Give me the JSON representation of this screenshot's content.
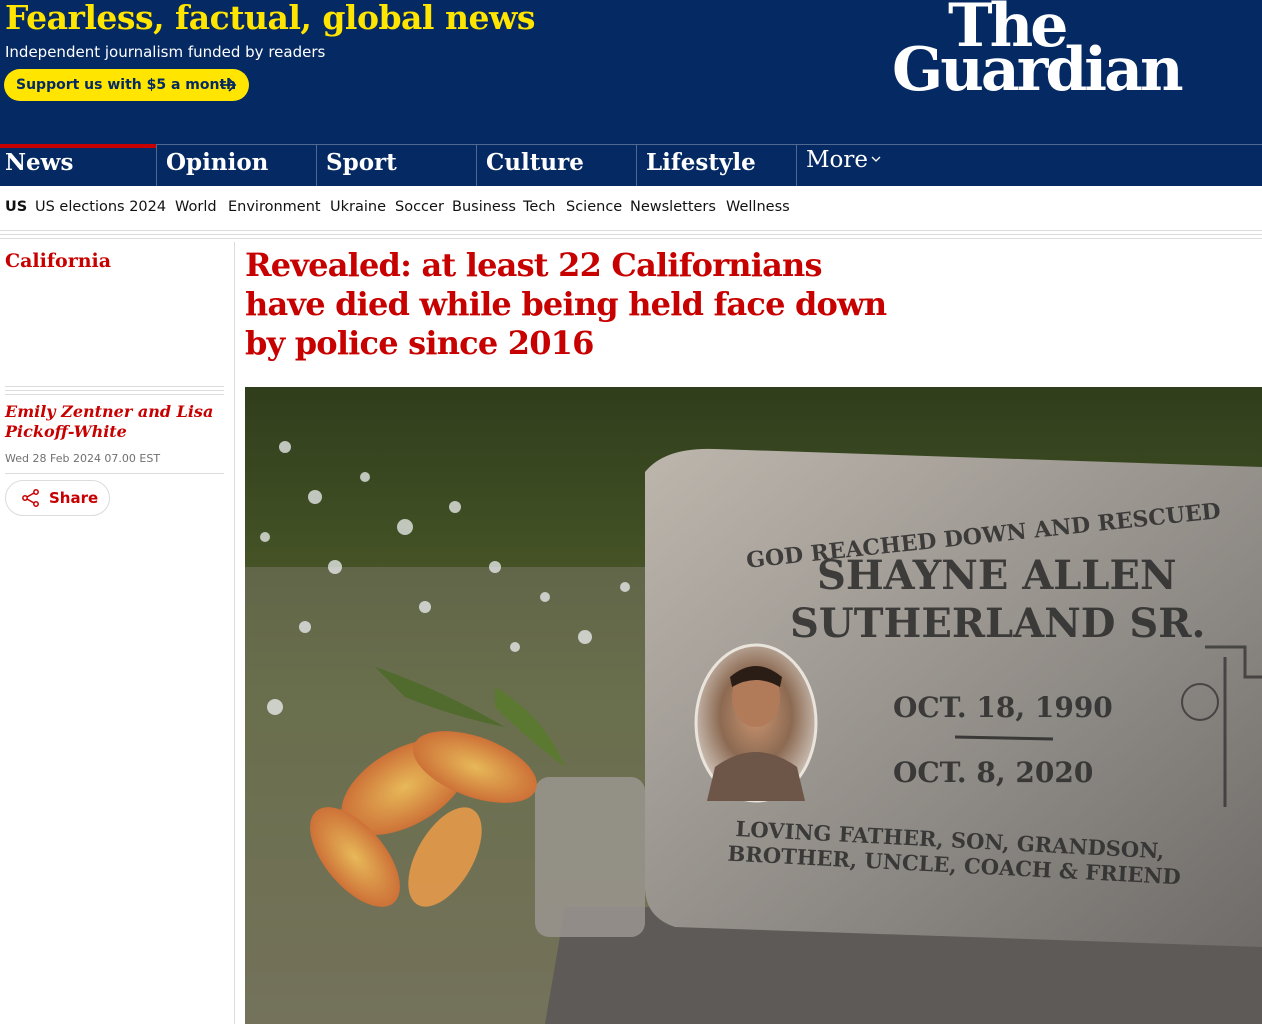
{
  "masthead": {
    "tagline": "Fearless, factual, global news",
    "subline": "Independent journalism funded by readers",
    "support_label": "Support us with $5 a month",
    "logo_line1": "The",
    "logo_line2": "Guardian",
    "bg_color": "#052962",
    "accent_color": "#ffe500"
  },
  "pillars": [
    {
      "label": "News",
      "active": true
    },
    {
      "label": "Opinion"
    },
    {
      "label": "Sport"
    },
    {
      "label": "Culture"
    },
    {
      "label": "Lifestyle"
    },
    {
      "label": "More"
    }
  ],
  "subnav": [
    "US",
    "US elections 2024",
    "World",
    "Environment",
    "Ukraine",
    "Soccer",
    "Business",
    "Tech",
    "Science",
    "Newsletters",
    "Wellness"
  ],
  "article": {
    "section": "California",
    "byline": "Emily Zentner and Lisa Pickoff-White",
    "date": "Wed 28 Feb 2024 07.00 EST",
    "share_label": "Share",
    "headline": "Revealed: at least 22 Californians have died while being held face down by police since 2016",
    "accent_color": "#c70000"
  },
  "hero_image": {
    "alt_subject": "headstone with flowers",
    "engraving": {
      "arc": "GOD REACHED DOWN AND RESCUED",
      "name1": "SHAYNE ALLEN",
      "name2": "SUTHERLAND SR.",
      "born": "OCT. 18, 1990",
      "died": "OCT. 8, 2020",
      "epitaph1": "LOVING FATHER, SON, GRANDSON,",
      "epitaph2": "BROTHER, UNCLE, COACH & FRIEND"
    }
  }
}
